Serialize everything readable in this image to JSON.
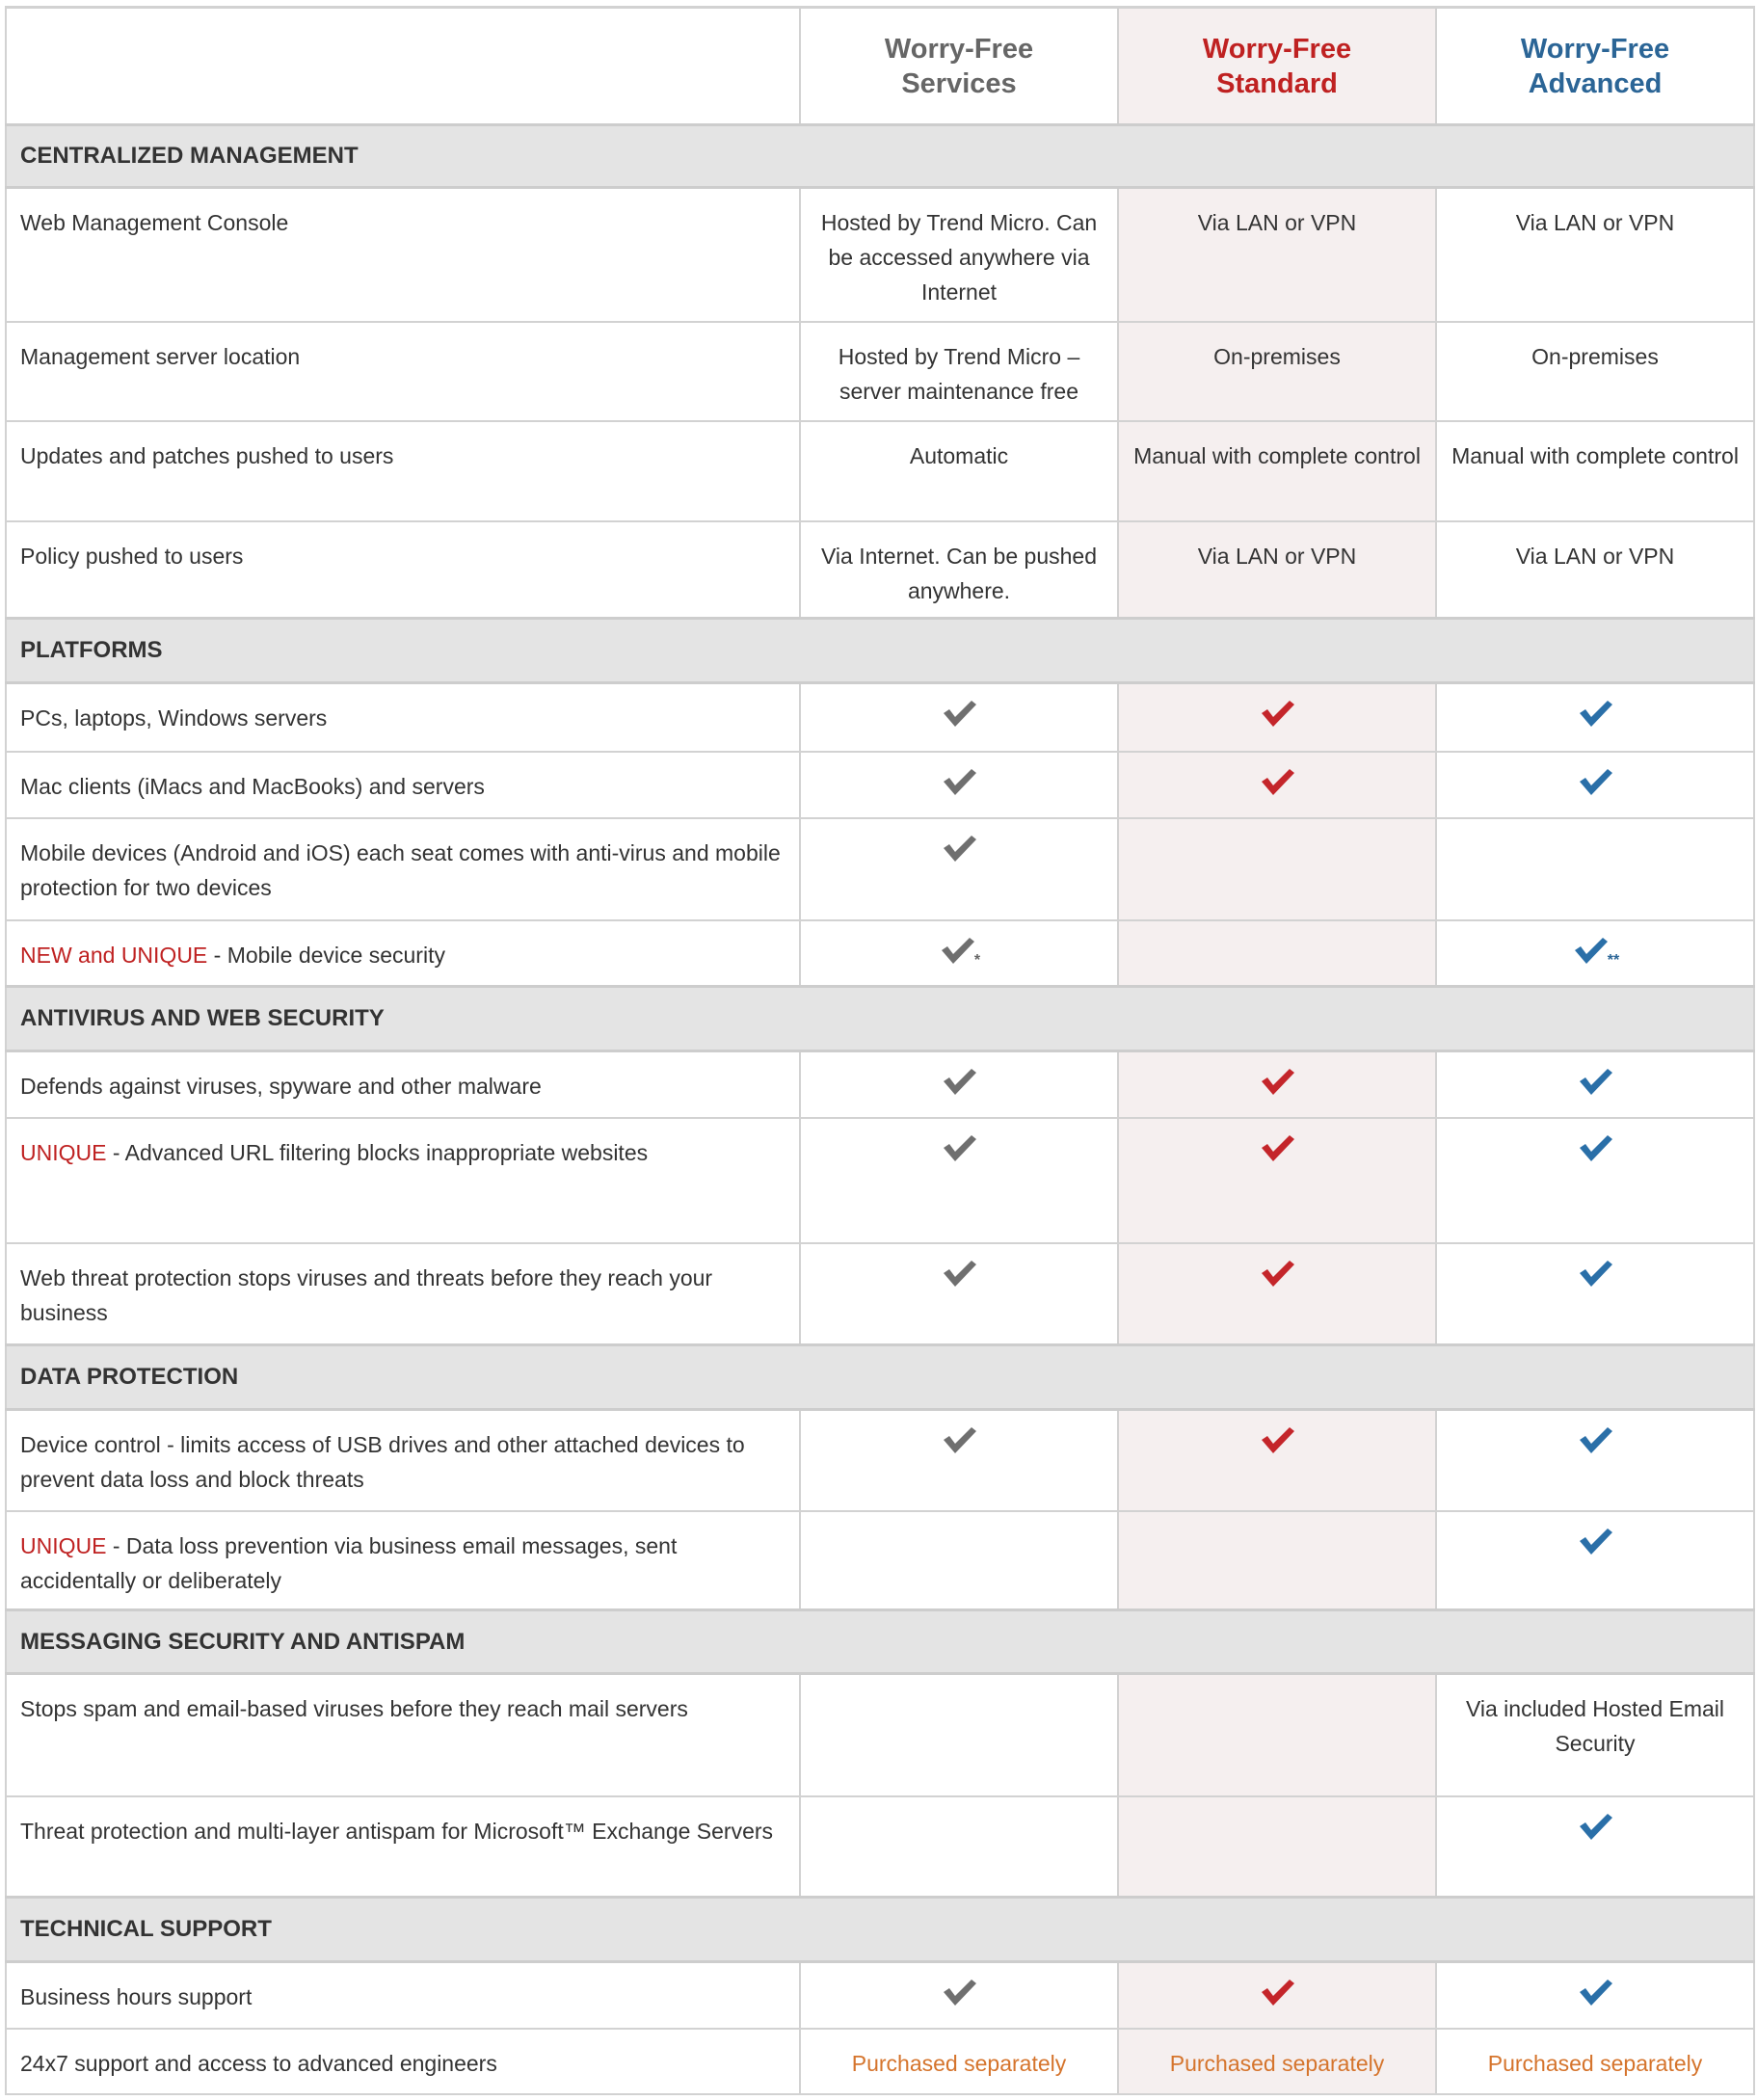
{
  "columns": {
    "services": "Worry-Free\nServices",
    "services_line1": "Worry-Free",
    "services_line2": "Services",
    "standard_line1": "Worry-Free",
    "standard_line2": "Standard",
    "advanced_line1": "Worry-Free",
    "advanced_line2": "Advanced"
  },
  "colors": {
    "services": "#666666",
    "standard": "#bf2121",
    "advanced": "#2b6596",
    "highlight": "#bf2121",
    "purchased": "#d5742c",
    "section_bg": "#e4e4e4",
    "standard_col_bg": "#f5efef"
  },
  "sections": [
    {
      "title": "CENTRALIZED MANAGEMENT",
      "rows": [
        {
          "label": "Web Management Console",
          "services": "Hosted by Trend Micro. Can be accessed anywhere via Internet",
          "standard": "Via LAN or VPN",
          "advanced": "Via LAN or VPN"
        },
        {
          "label": "Management server location",
          "services": "Hosted by Trend Micro – server maintenance free",
          "standard": "On-premises",
          "advanced": "On-premises"
        },
        {
          "label": "Updates and patches pushed to users",
          "services": "Automatic",
          "standard": "Manual with complete control",
          "advanced": "Manual with complete control"
        },
        {
          "label": "Policy pushed to users",
          "services": "Via Internet. Can be pushed anywhere.",
          "standard": "Via LAN or VPN",
          "advanced": "Via LAN or VPN"
        }
      ]
    },
    {
      "title": "PLATFORMS",
      "rows": [
        {
          "label": "PCs, laptops, Windows servers",
          "services": "check",
          "standard": "check",
          "advanced": "check"
        },
        {
          "label": "Mac clients (iMacs and MacBooks) and servers",
          "services": "check",
          "standard": "check",
          "advanced": "check"
        },
        {
          "label": "Mobile devices (Android and iOS) each seat comes with anti-virus and mobile protection for two devices",
          "services": "check",
          "standard": "",
          "advanced": ""
        },
        {
          "label_highlight": "NEW and UNIQUE",
          "label": " - Mobile device security",
          "services": "check",
          "services_note": "*",
          "standard": "",
          "advanced": "check",
          "advanced_note": "**"
        }
      ]
    },
    {
      "title": "ANTIVIRUS AND WEB SECURITY",
      "rows": [
        {
          "label": "Defends against viruses, spyware and other malware",
          "services": "check",
          "standard": "check",
          "advanced": "check"
        },
        {
          "label_highlight": "UNIQUE",
          "label": " - Advanced URL filtering blocks inappropriate websites",
          "services": "check",
          "standard": "check",
          "advanced": "check"
        },
        {
          "label": "Web threat protection stops viruses and threats  before they reach your business",
          "services": "check",
          "standard": "check",
          "advanced": "check"
        }
      ]
    },
    {
      "title": "DATA PROTECTION",
      "rows": [
        {
          "label": "Device control - limits access of USB drives and other attached devices to prevent data loss and block threats",
          "services": "check",
          "standard": "check",
          "advanced": "check"
        },
        {
          "label_highlight": "UNIQUE",
          "label": " - Data loss prevention via business email messages, sent accidentally or deliberately",
          "services": "",
          "standard": "",
          "advanced": "check"
        }
      ]
    },
    {
      "title": "MESSAGING SECURITY AND ANTISPAM",
      "rows": [
        {
          "label": "Stops spam and email-based viruses before they reach mail servers",
          "services": "",
          "standard": "",
          "advanced": "Via included Hosted Email Security"
        },
        {
          "label": "Threat protection and multi-layer antispam for Microsoft™ Exchange Servers",
          "services": "",
          "standard": "",
          "advanced": "check"
        }
      ]
    },
    {
      "title": "TECHNICAL SUPPORT",
      "rows": [
        {
          "label": "Business hours support",
          "services": "check",
          "standard": "check",
          "advanced": "check"
        },
        {
          "label": "24x7 support and access to advanced engineers",
          "services": "Purchased separately",
          "standard": "Purchased separately",
          "advanced": "Purchased separately"
        }
      ]
    }
  ],
  "icons": {
    "check": "check-icon"
  }
}
